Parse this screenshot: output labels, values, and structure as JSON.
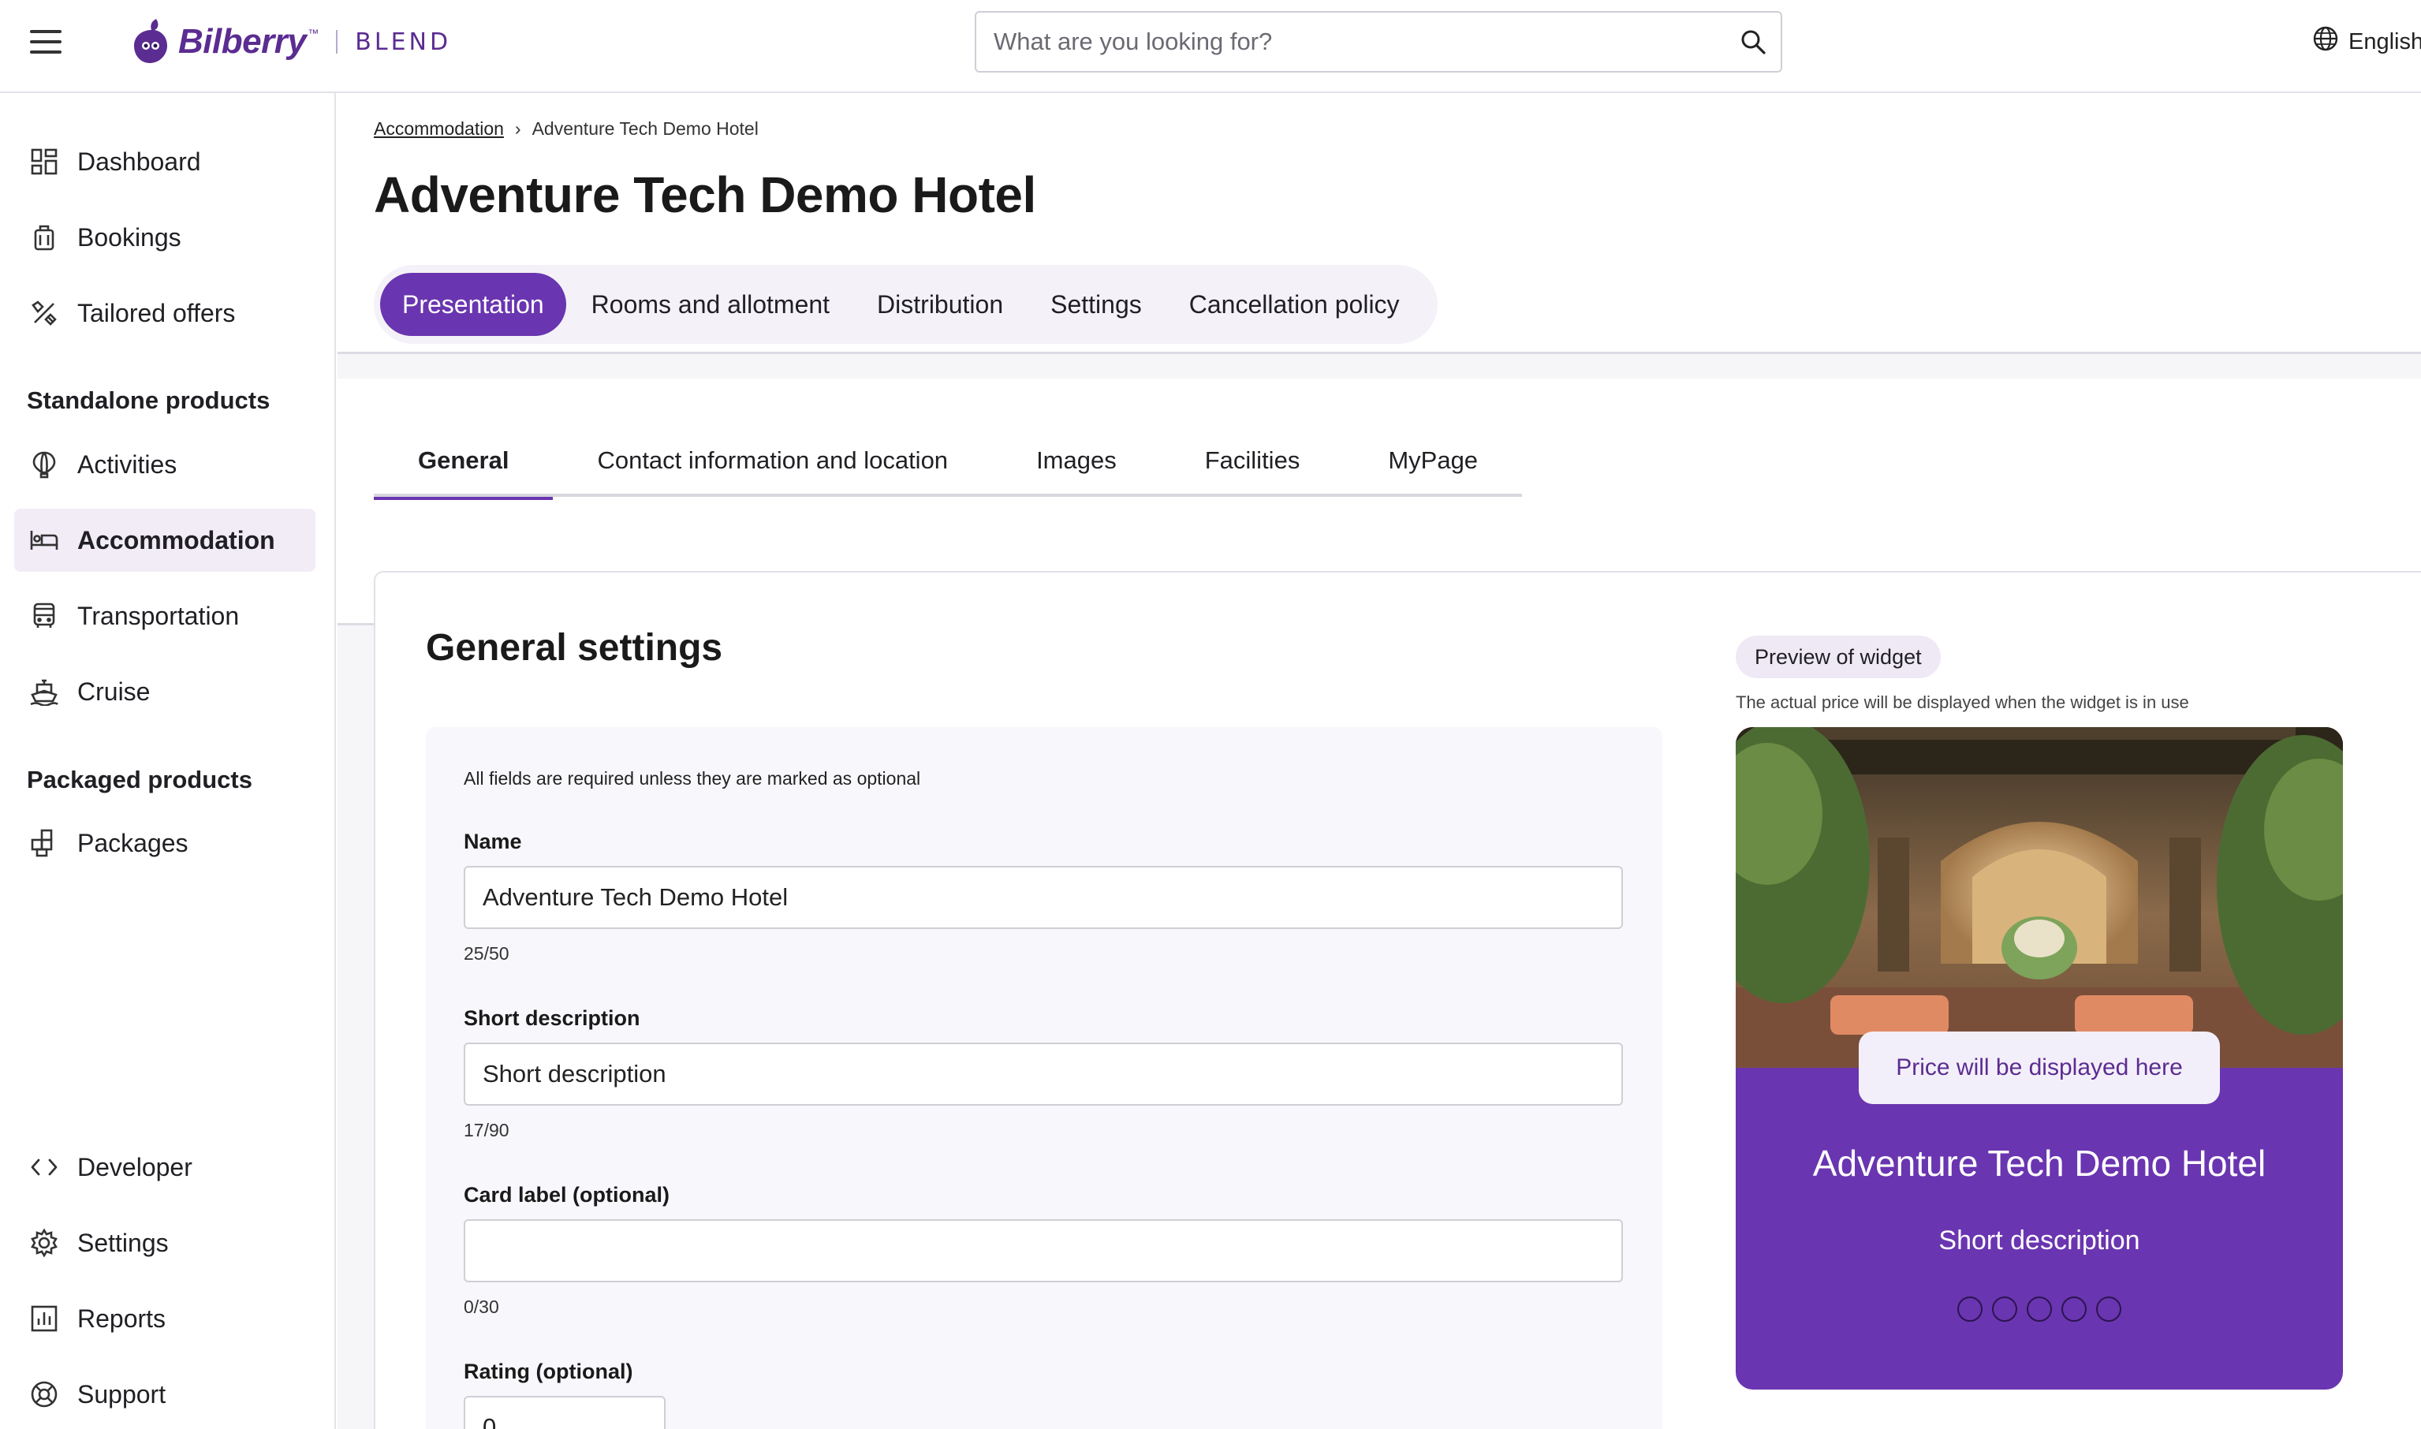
{
  "header": {
    "brand": "Bilberry",
    "brand_sub": "BLEND",
    "search_placeholder": "What are you looking for?",
    "language": "English",
    "icons": [
      "menu-icon",
      "search-icon",
      "globe-icon"
    ]
  },
  "sidebar": {
    "items": [
      {
        "label": "Dashboard",
        "icon": "dashboard-icon"
      },
      {
        "label": "Bookings",
        "icon": "suitcase-icon"
      },
      {
        "label": "Tailored offers",
        "icon": "tools-icon"
      },
      {
        "label": "Activities",
        "icon": "balloon-icon"
      },
      {
        "label": "Accommodation",
        "icon": "bed-icon",
        "active": true
      },
      {
        "label": "Transportation",
        "icon": "bus-icon"
      },
      {
        "label": "Cruise",
        "icon": "ship-icon"
      },
      {
        "label": "Packages",
        "icon": "package-icon"
      },
      {
        "label": "Developer",
        "icon": "code-icon"
      },
      {
        "label": "Settings",
        "icon": "gear-icon"
      },
      {
        "label": "Reports",
        "icon": "chart-icon"
      },
      {
        "label": "Support",
        "icon": "lifebuoy-icon"
      }
    ],
    "section_standalone": "Standalone products",
    "section_packaged": "Packaged products"
  },
  "breadcrumb": {
    "parent": "Accommodation",
    "current": "Adventure Tech Demo Hotel"
  },
  "page_title": "Adventure Tech Demo Hotel",
  "main_tabs": [
    {
      "label": "Presentation",
      "active": true
    },
    {
      "label": "Rooms and allotment"
    },
    {
      "label": "Distribution"
    },
    {
      "label": "Settings"
    },
    {
      "label": "Cancellation policy"
    }
  ],
  "sub_tabs": [
    {
      "label": "General",
      "active": true
    },
    {
      "label": "Contact information and location"
    },
    {
      "label": "Images"
    },
    {
      "label": "Facilities"
    },
    {
      "label": "MyPage"
    }
  ],
  "general": {
    "title": "General settings",
    "note": "All fields are required unless they are marked as optional",
    "name_label": "Name",
    "name_value": "Adventure Tech Demo Hotel",
    "name_count": "25/50",
    "short_label": "Short description",
    "short_value": "Short description",
    "short_count": "17/90",
    "card_label": "Card label (optional)",
    "card_value": "",
    "card_count": "0/30",
    "rating_label": "Rating (optional)",
    "rating_value": "0"
  },
  "preview": {
    "chip": "Preview of widget",
    "note": "The actual price will be displayed when the widget is in use",
    "price": "Price will be displayed here",
    "title": "Adventure Tech Demo Hotel",
    "description": "Short description",
    "rating_dots": 5
  },
  "colors": {
    "accent": "#6a35b0",
    "brand": "#5b2c91",
    "active_nav_bg": "#f1ecf6"
  }
}
